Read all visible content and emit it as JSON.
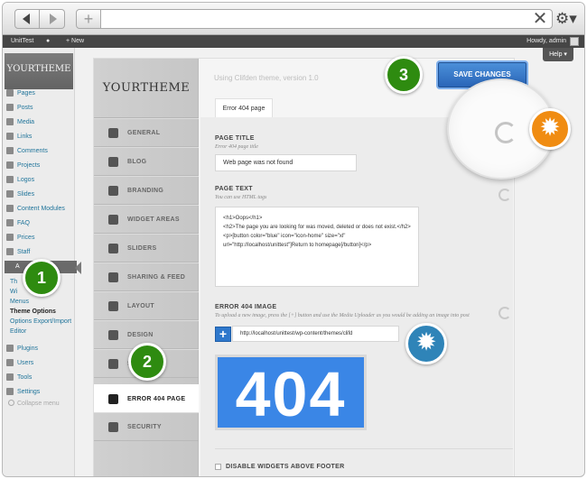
{
  "browser": {
    "back_icon": "back-arrow-icon",
    "forward_icon": "forward-arrow-icon",
    "new_tab": "+",
    "address": "",
    "close_icon": "close-icon",
    "settings_icon": "gear-icon"
  },
  "admin_bar": {
    "site_name": "UnitTest",
    "new_label": "New",
    "greeting": "Howdy, admin",
    "help": "Help ▾"
  },
  "sidebar": {
    "logo": "YOURTHEME",
    "items": [
      {
        "label": "Pages"
      },
      {
        "label": "Posts"
      },
      {
        "label": "Media"
      },
      {
        "label": "Links"
      },
      {
        "label": "Comments"
      },
      {
        "label": "Projects"
      },
      {
        "label": "Logos"
      },
      {
        "label": "Slides"
      },
      {
        "label": "Content Modules"
      },
      {
        "label": "FAQ"
      },
      {
        "label": "Prices"
      },
      {
        "label": "Staff"
      }
    ],
    "appearance": "A",
    "submenu": [
      "Th",
      "Wi",
      "Menus",
      "Theme Options",
      "Options Export/Import",
      "Editor"
    ],
    "items_after": [
      {
        "label": "Plugins"
      },
      {
        "label": "Users"
      },
      {
        "label": "Tools"
      },
      {
        "label": "Settings"
      }
    ],
    "collapse": "Collapse menu"
  },
  "options": {
    "logo": "YOURTHEME",
    "version": "Using Clifden theme, version 1.0",
    "save": "SAVE CHANGES",
    "tab": "Error 404 page",
    "nav": [
      {
        "label": "GENERAL",
        "icon": "tools-icon"
      },
      {
        "label": "BLOG",
        "icon": "printer-icon"
      },
      {
        "label": "BRANDING",
        "icon": "image-icon"
      },
      {
        "label": "WIDGET AREAS",
        "icon": "widgets-icon"
      },
      {
        "label": "SLIDERS",
        "icon": "slider-icon"
      },
      {
        "label": "SHARING & FEED",
        "icon": "link-icon"
      },
      {
        "label": "LAYOUT",
        "icon": "layout-icon"
      },
      {
        "label": "DESIGN",
        "icon": "brush-icon"
      },
      {
        "label": "S",
        "icon": "search-icon"
      },
      {
        "label": "ERROR 404 PAGE",
        "icon": "warning-icon"
      },
      {
        "label": "SECURITY",
        "icon": "shield-icon"
      }
    ],
    "page_title": {
      "label": "PAGE TITLE",
      "hint": "Error 404 page title",
      "value": "Web page was not found"
    },
    "page_text": {
      "label": "PAGE TEXT",
      "hint": "You can use HTML tags",
      "lines": [
        "<h1>Oops</h1>",
        "<h2>The page you are looking for was moved, deleted or does not exist.</h2>",
        "<p>[button color=\"blue\" icon=\"icon-home\" size=\"xl\" url=\"http://localhost/unittest\"]Return to homepage[/button]</p>"
      ]
    },
    "error_image": {
      "label": "ERROR 404 IMAGE",
      "hint": "To upload a new image, press the [+] button and use the Media Uploader as you would be adding an image into post",
      "upload_button": "+",
      "url": "http://localhost/unittest/wp-content/themes/clifd",
      "preview_text": "404"
    },
    "disable_widgets": "DISABLE WIDGETS ABOVE FOOTER"
  },
  "callouts": {
    "one": "1",
    "two": "2",
    "three": "3",
    "gear_orange": "✹",
    "gear_blue": "✹"
  },
  "colors": {
    "save_blue": "#2a66b8",
    "callout_green": "#2e8b10",
    "callout_orange": "#f08c12",
    "callout_blue": "#2f84b8",
    "image_blue": "#3a86e6"
  }
}
